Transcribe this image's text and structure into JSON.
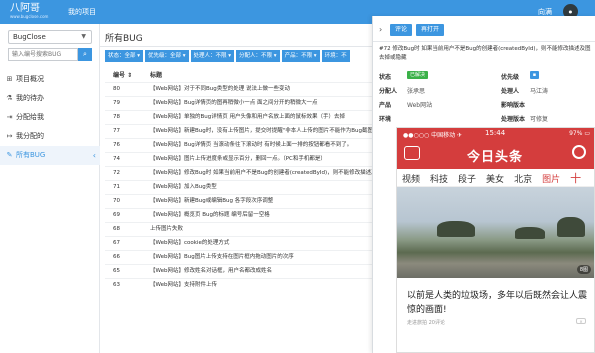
{
  "topbar": {
    "logo_main": "八阿哥",
    "logo_sub": "www.bugclose.com",
    "project_link": "我的项目",
    "user_name": "向满",
    "avatar_text": "avatar"
  },
  "sidebar": {
    "project_select": "BugClose",
    "search_placeholder": "输入编号搜索BUG",
    "items": [
      {
        "label": "项目概况",
        "icon": "sitemap-icon"
      },
      {
        "label": "我的待办",
        "icon": "flask-icon"
      },
      {
        "label": "分配给我",
        "icon": "sign-in-icon"
      },
      {
        "label": "我分配的",
        "icon": "sign-out-icon"
      },
      {
        "label": "所有BUG",
        "icon": "wrench-icon"
      }
    ]
  },
  "main": {
    "title": "所有BUG",
    "filters": [
      "状态：全部 ▾",
      "优先级：全部 ▾",
      "处理人：不限 ▾",
      "分配人：不限 ▾",
      "产品：不限 ▾",
      "环境：不"
    ],
    "columns": {
      "id": "编号 ⇕",
      "title": "标题"
    },
    "rows": [
      {
        "id": "80",
        "title": "【Web网站】对于不同Bug类型的处理 说法上做一些变动"
      },
      {
        "id": "79",
        "title": "【Web网站】Bug详情页的图再稍微小一点 面之间分开的稍微大一点"
      },
      {
        "id": "78",
        "title": "【Web网站】单独的Bug详情页 用户头像和用户名放上面的鼠标效果（手）去掉"
      },
      {
        "id": "77",
        "title": "【Web网站】新建Bug时，没有上传图片，提交时提醒\"非本人上传的图片不能作为Bug截图\""
      },
      {
        "id": "76",
        "title": "【Web网站】Bug详情页 当滚动条往下滚动时 有时候上面一排的按钮都看不到了。"
      },
      {
        "id": "74",
        "title": "【Web网站】图片上传进度条或显示百分，删回一点。（PC和手机都是）"
      },
      {
        "id": "72",
        "title": "【Web网站】修改Bug时 如果当前用户不是Bug的创建者(createdById)，则不能修改描述及图片 编辑时去掉或隐藏"
      },
      {
        "id": "71",
        "title": "【Web网站】加入Bug类型"
      },
      {
        "id": "70",
        "title": "【Web网站】新建Bug或编辑Bug 各字段次序调整"
      },
      {
        "id": "69",
        "title": "【Web网站】概览页 Bug的标题 编号后留一空格"
      },
      {
        "id": "68",
        "title": "上传图片失败"
      },
      {
        "id": "67",
        "title": "【Web网站】cookie的处理方式"
      },
      {
        "id": "66",
        "title": "【Web网站】Bug图片上传支持在图片框内拖动图片的次序"
      },
      {
        "id": "65",
        "title": "【Web网站】修改姓名对话框，用户名都改成姓名"
      },
      {
        "id": "63",
        "title": "【Web网站】支持附件上传"
      }
    ]
  },
  "detail": {
    "close_icon": "chevron-right-icon",
    "btn_comment": "评论",
    "btn_reopen": "再打开",
    "title": "#72 修改Bug时 如果当前用户不是Bug的创建者(createdById)，则不能修改描述及图片 编辑时",
    "title_cont": "去掉或隐藏",
    "fields": {
      "status_label": "状态",
      "status_value": "已解决",
      "priority_label": "优先级",
      "assigner_label": "分配人",
      "assigner_value": "张承思",
      "handler_label": "处理人",
      "handler_value": "马江涛",
      "product_label": "产品",
      "product_value": "Web网站",
      "impact_label": "影响版本",
      "impact_value": "",
      "env_label": "环境",
      "handle_ver_label": "处理版本",
      "handle_ver_value": "可修复"
    }
  },
  "phone": {
    "carrier": "●●○○○ 中国移动 ✈",
    "time": "15:44",
    "battery": "97% ▭",
    "brand": "今日头条",
    "tabs": [
      "视频",
      "科技",
      "段子",
      "美女",
      "北京",
      "图片"
    ],
    "active_tab": "图片",
    "plus": "十",
    "image_count": "8图",
    "headline": "以前是人类的垃圾场，多年以后既然会让人震惊的画面!",
    "meta": "走进旅拍  20评论",
    "dismiss": "×"
  },
  "colors": {
    "accent": "#3c96e0",
    "toutiao_red": "#d43d3d",
    "resolved_green": "#3bb149"
  }
}
